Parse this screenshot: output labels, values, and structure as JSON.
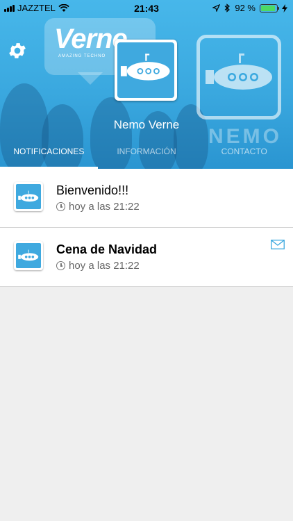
{
  "status_bar": {
    "carrier": "JAZZTEL",
    "time": "21:43",
    "battery": "92 %",
    "battery_level": 0.92
  },
  "header": {
    "logo_text": "Verne",
    "logo_tagline": "AMAZING TECHNO",
    "brand_word": "NEMO",
    "profile_name": "Nemo Verne",
    "accent_color": "#3aa8df"
  },
  "tabs": [
    {
      "label": "NOTIFICACIONES",
      "active": true
    },
    {
      "label": "INFORMACIÓN",
      "active": false
    },
    {
      "label": "CONTACTO",
      "active": false
    }
  ],
  "notifications": [
    {
      "title": "Bienvenido!!!",
      "time": "hoy a las 21:22",
      "unread": false
    },
    {
      "title": "Cena de Navidad",
      "time": "hoy a las 21:22",
      "unread": true
    }
  ]
}
